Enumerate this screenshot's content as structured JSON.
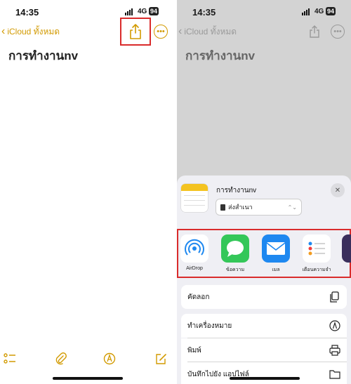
{
  "left": {
    "status": {
      "time": "14:35",
      "network": "4G",
      "battery": "94"
    },
    "nav": {
      "back_label": "iCloud ทั้งหมด"
    },
    "note_title": "การทำงานnv"
  },
  "right": {
    "status": {
      "time": "14:35",
      "network": "4G",
      "battery": "94"
    },
    "nav": {
      "back_label": "iCloud ทั้งหมด"
    },
    "note_title": "การทำงานnv",
    "share_sheet": {
      "title": "การทำงานnv",
      "send_option": "ส่งสำเนา",
      "apps": [
        {
          "label": "AirDrop",
          "icon": "airdrop-icon"
        },
        {
          "label": "ข้อความ",
          "icon": "messages-icon"
        },
        {
          "label": "เมล",
          "icon": "mail-icon"
        },
        {
          "label": "เตือนความจำ",
          "icon": "reminders-icon"
        }
      ],
      "actions": [
        {
          "label": "คัดลอก",
          "icon": "copy-icon"
        },
        {
          "label": "ทำเครื่องหมาย",
          "icon": "markup-icon"
        },
        {
          "label": "พิมพ์",
          "icon": "printer-icon"
        },
        {
          "label": "บันทึกไปยัง แอปไฟล์",
          "icon": "folder-icon"
        }
      ]
    }
  },
  "colors": {
    "accent": "#d29a00",
    "highlight": "#d92b2b",
    "messages": "#34c759",
    "mail": "#1e88f0"
  }
}
